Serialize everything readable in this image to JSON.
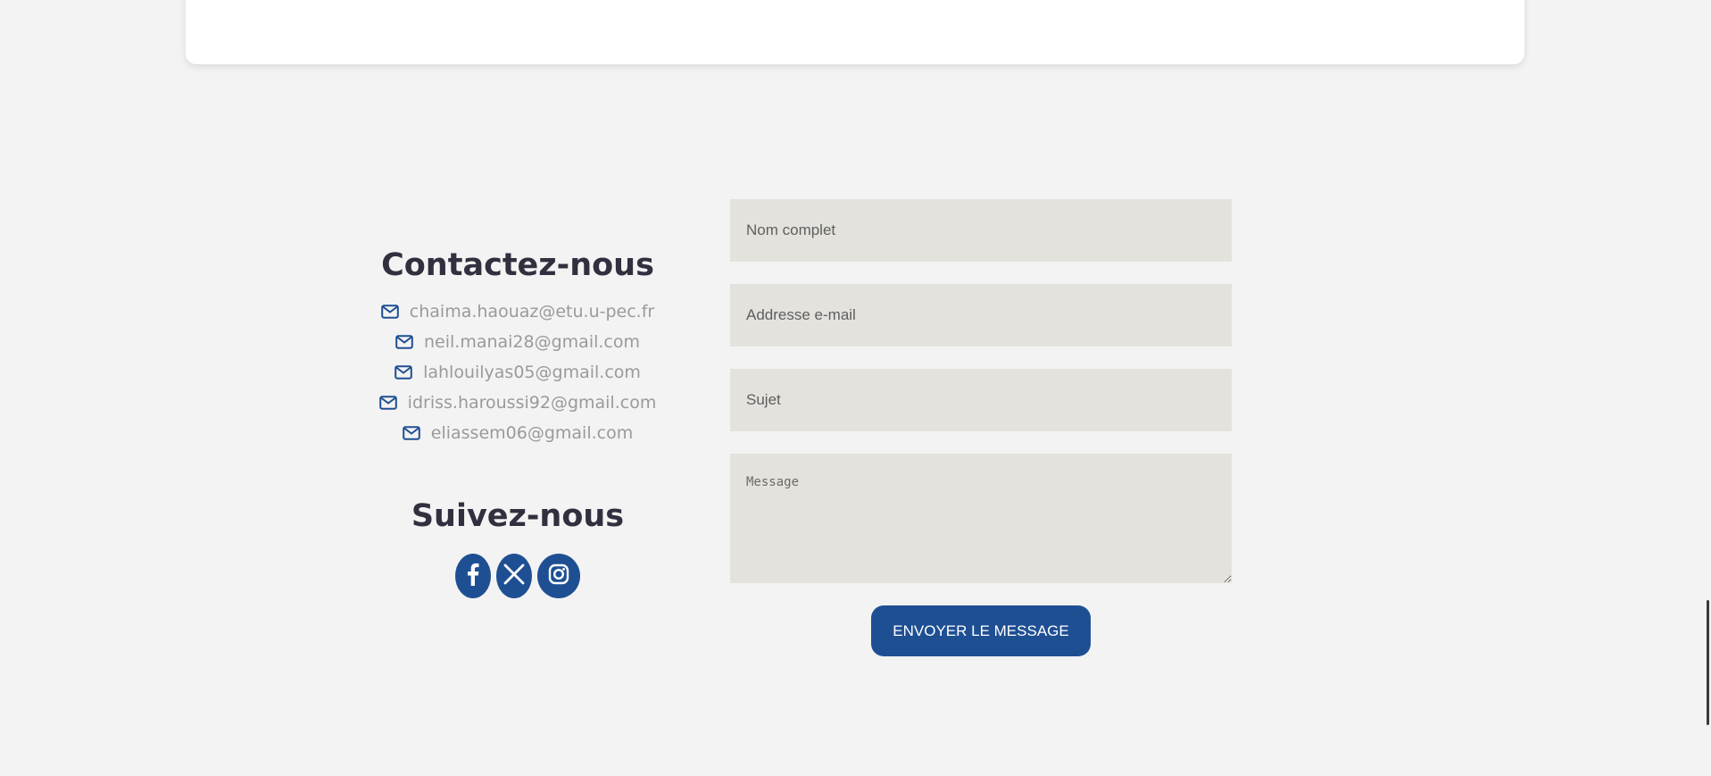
{
  "contact": {
    "title": "Contactez-nous",
    "emails": [
      "chaima.haouaz@etu.u-pec.fr",
      "neil.manai28@gmail.com",
      "lahlouilyas05@gmail.com",
      "idriss.haroussi92@gmail.com",
      "eliassem06@gmail.com"
    ]
  },
  "follow": {
    "title": "Suivez-nous",
    "socials": [
      "facebook-icon",
      "x-icon",
      "instagram-icon"
    ]
  },
  "form": {
    "name_placeholder": "Nom complet",
    "email_placeholder": "Addresse e-mail",
    "subject_placeholder": "Sujet",
    "message_placeholder": "Message",
    "submit_label": "ENVOYER LE MESSAGE"
  },
  "colors": {
    "accent": "#1f4f93",
    "background": "#f3f3f3",
    "field_background": "#e3e2dd",
    "heading": "#31303f",
    "email_text": "#9a9a9a"
  }
}
